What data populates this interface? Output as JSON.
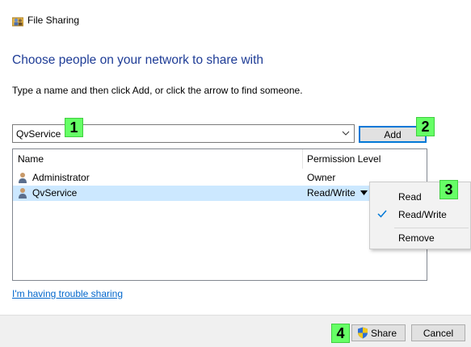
{
  "window": {
    "title": "File Sharing",
    "icon": "file-sharing-icon"
  },
  "heading": "Choose people on your network to share with",
  "instruction": "Type a name and then click Add, or click the arrow to find someone.",
  "name_input": {
    "value": "QvService"
  },
  "add_button": {
    "label": "Add"
  },
  "list": {
    "columns": [
      "Name",
      "Permission Level"
    ],
    "rows": [
      {
        "name": "Administrator",
        "permission": "Owner",
        "icon": "user-icon"
      },
      {
        "name": "QvService",
        "permission": "Read/Write",
        "icon": "user-icon",
        "selected": true
      }
    ]
  },
  "permission_menu": {
    "items": [
      {
        "label": "Read",
        "checked": false
      },
      {
        "label": "Read/Write",
        "checked": true
      },
      {
        "label": "Remove",
        "checked": false
      }
    ]
  },
  "trouble_link": "I'm having trouble sharing",
  "footer": {
    "share_label": "Share",
    "cancel_label": "Cancel"
  },
  "step_markers": [
    "1",
    "2",
    "3",
    "4"
  ],
  "colors": {
    "heading": "#1e3c96",
    "selection": "#cce8ff",
    "accent": "#0078d7",
    "link": "#0066cc",
    "step_marker": "#66ff66"
  }
}
